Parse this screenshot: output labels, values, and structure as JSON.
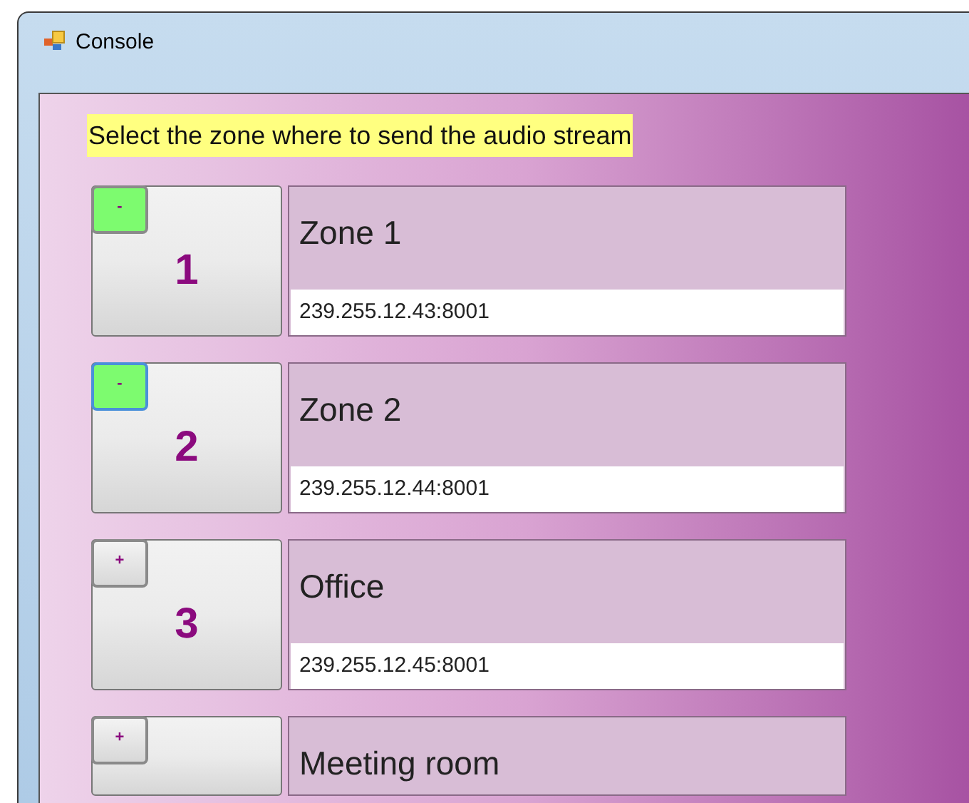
{
  "window": {
    "title": "Console"
  },
  "instruction": "Select the zone where to send the audio stream",
  "zones": [
    {
      "number": "1",
      "toggle": "-",
      "active": true,
      "focused": false,
      "name": "Zone 1",
      "address": "239.255.12.43:8001"
    },
    {
      "number": "2",
      "toggle": "-",
      "active": true,
      "focused": true,
      "name": "Zone 2",
      "address": "239.255.12.44:8001"
    },
    {
      "number": "3",
      "toggle": "+",
      "active": false,
      "focused": false,
      "name": "Office",
      "address": "239.255.12.45:8001"
    },
    {
      "toggle": "+",
      "active": false,
      "focused": false,
      "name": "Meeting room"
    }
  ]
}
